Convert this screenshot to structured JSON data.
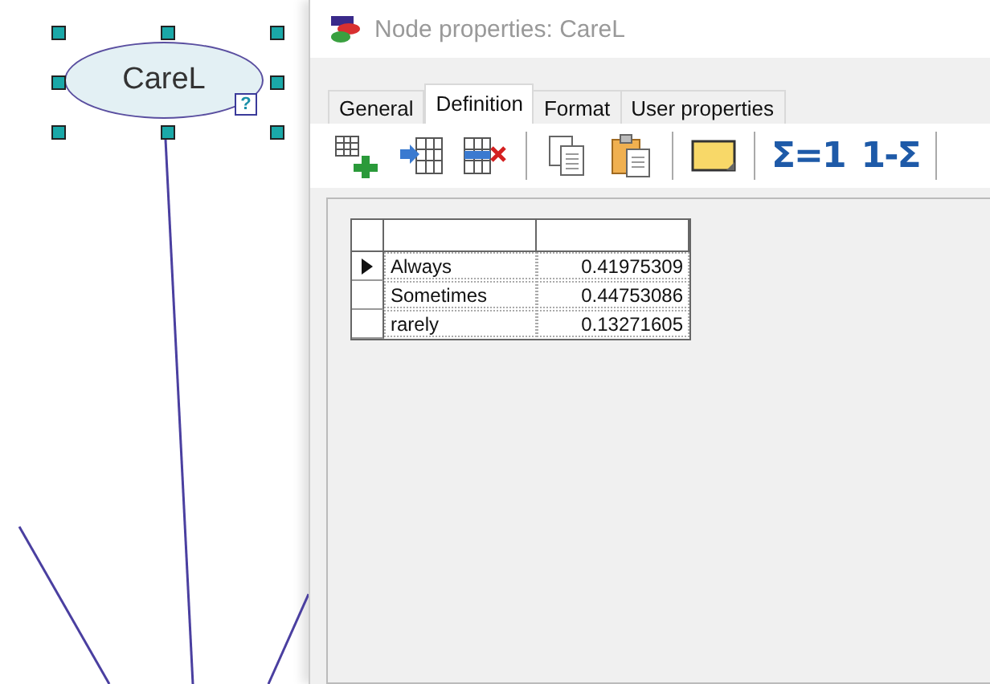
{
  "canvas": {
    "node": {
      "label": "CareL",
      "selected": true,
      "badge": "?"
    }
  },
  "dialog": {
    "title": "Node properties: CareL",
    "tabs": [
      {
        "label": "General",
        "selected": false
      },
      {
        "label": "Definition",
        "selected": true
      },
      {
        "label": "Format",
        "selected": false
      },
      {
        "label": "User properties",
        "selected": false
      }
    ],
    "toolbar": [
      {
        "kind": "add-row"
      },
      {
        "kind": "insert"
      },
      {
        "kind": "delete"
      },
      {
        "kind": "sep"
      },
      {
        "kind": "copy"
      },
      {
        "kind": "paste"
      },
      {
        "kind": "sep"
      },
      {
        "kind": "note"
      },
      {
        "kind": "sep"
      },
      {
        "kind": "text",
        "label": "Σ=1"
      },
      {
        "kind": "text",
        "label": "1-Σ"
      },
      {
        "kind": "sep"
      }
    ],
    "table": {
      "rows": [
        {
          "state": "Always",
          "value": "0.41975309",
          "current": true
        },
        {
          "state": "Sometimes",
          "value": "0.44753086",
          "current": false
        },
        {
          "state": "rarely",
          "value": "0.13271605",
          "current": false
        }
      ]
    }
  }
}
